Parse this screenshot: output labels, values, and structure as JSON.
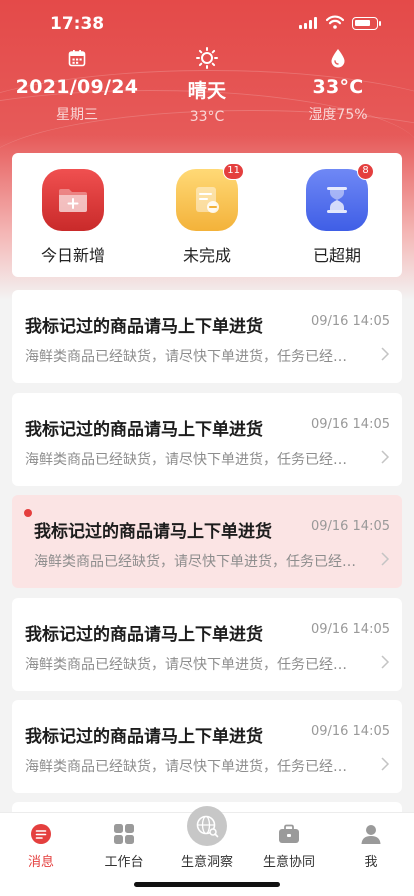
{
  "status_bar": {
    "time": "17:38"
  },
  "weather": {
    "date": "2021/09/24",
    "weekday": "星期三",
    "condition": "晴天",
    "condition_temp": "33°C",
    "temperature": "33°C",
    "humidity": "湿度75%"
  },
  "quick_actions": [
    {
      "label": "今日新增",
      "badge": "",
      "icon": "folder-add-icon",
      "color": "#e03a3a"
    },
    {
      "label": "未完成",
      "badge": "11",
      "icon": "document-minus-icon",
      "color": "#f5bf4f"
    },
    {
      "label": "已超期",
      "badge": "8",
      "icon": "hourglass-icon",
      "color": "#4f6ef0"
    }
  ],
  "messages": [
    {
      "title": "我标记过的商品请马上下单进货",
      "time": "09/16 14:05",
      "desc": "海鲜类商品已经缺货，请尽快下单进货，任务已经超期",
      "unread": false
    },
    {
      "title": "我标记过的商品请马上下单进货",
      "time": "09/16 14:05",
      "desc": "海鲜类商品已经缺货，请尽快下单进货，任务已经超期",
      "unread": false
    },
    {
      "title": "我标记过的商品请马上下单进货",
      "time": "09/16 14:05",
      "desc": "海鲜类商品已经缺货，请尽快下单进货，任务已经超期",
      "unread": true
    },
    {
      "title": "我标记过的商品请马上下单进货",
      "time": "09/16 14:05",
      "desc": "海鲜类商品已经缺货，请尽快下单进货，任务已经超期",
      "unread": false
    },
    {
      "title": "我标记过的商品请马上下单进货",
      "time": "09/16 14:05",
      "desc": "海鲜类商品已经缺货，请尽快下单进货，任务已经超期",
      "unread": false
    }
  ],
  "tabbar": {
    "items": [
      {
        "label": "消息",
        "icon": "message-icon",
        "active": true
      },
      {
        "label": "工作台",
        "icon": "grid-icon",
        "active": false
      },
      {
        "label": "生意洞察",
        "icon": "globe-search-icon",
        "active": false
      },
      {
        "label": "生意协同",
        "icon": "briefcase-icon",
        "active": false
      },
      {
        "label": "我",
        "icon": "person-icon",
        "active": false
      }
    ]
  },
  "colors": {
    "accent": "#e43f3e",
    "header": "#e44a49",
    "highlight_bg": "#fbe4e4"
  }
}
